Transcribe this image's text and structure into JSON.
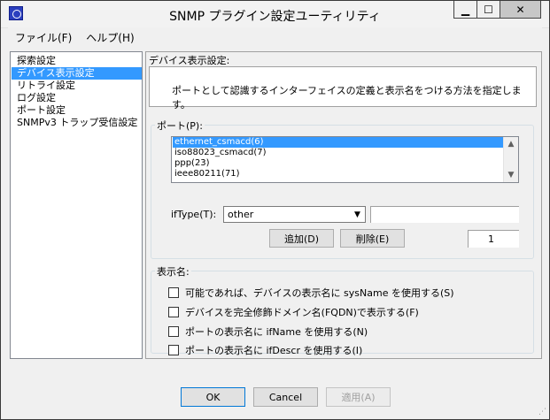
{
  "window": {
    "title": "SNMP プラグイン設定ユーティリティ",
    "minimize_glyph": "▁",
    "maximize_glyph": "☐",
    "close_glyph": "✕"
  },
  "menu": {
    "items": [
      "ファイル(F)",
      "ヘルプ(H)"
    ]
  },
  "nav": {
    "items": [
      "探索設定",
      "デバイス表示設定",
      "リトライ設定",
      "ログ設定",
      "ポート設定",
      "SNMPv3 トラップ受信設定"
    ],
    "selected_index": 1
  },
  "panel": {
    "title": "デバイス表示設定:",
    "description": "ポートとして認識するインターフェイスの定義と表示名をつける方法を指定します。"
  },
  "port_group": {
    "label": "ポート(P):",
    "list": [
      "ethernet_csmacd(6)",
      "iso88023_csmacd(7)",
      "ppp(23)",
      "ieee80211(71)"
    ],
    "selected_index": 0,
    "iftype_label": "ifType(T):",
    "iftype_value": "other",
    "iftype_text": "",
    "add_label": "追加(D)",
    "delete_label": "削除(E)",
    "count_value": "1"
  },
  "name_group": {
    "label": "表示名:",
    "options": [
      "可能であれば、デバイスの表示名に sysName を使用する(S)",
      "デバイスを完全修飾ドメイン名(FQDN)で表示する(F)",
      "ポートの表示名に ifName を使用する(N)",
      "ポートの表示名に ifDescr を使用する(I)"
    ]
  },
  "buttons": {
    "ok": "OK",
    "cancel": "Cancel",
    "apply": "適用(A)"
  },
  "colors": {
    "selection": "#3399ff",
    "window_bg": "#f0f0f0"
  }
}
